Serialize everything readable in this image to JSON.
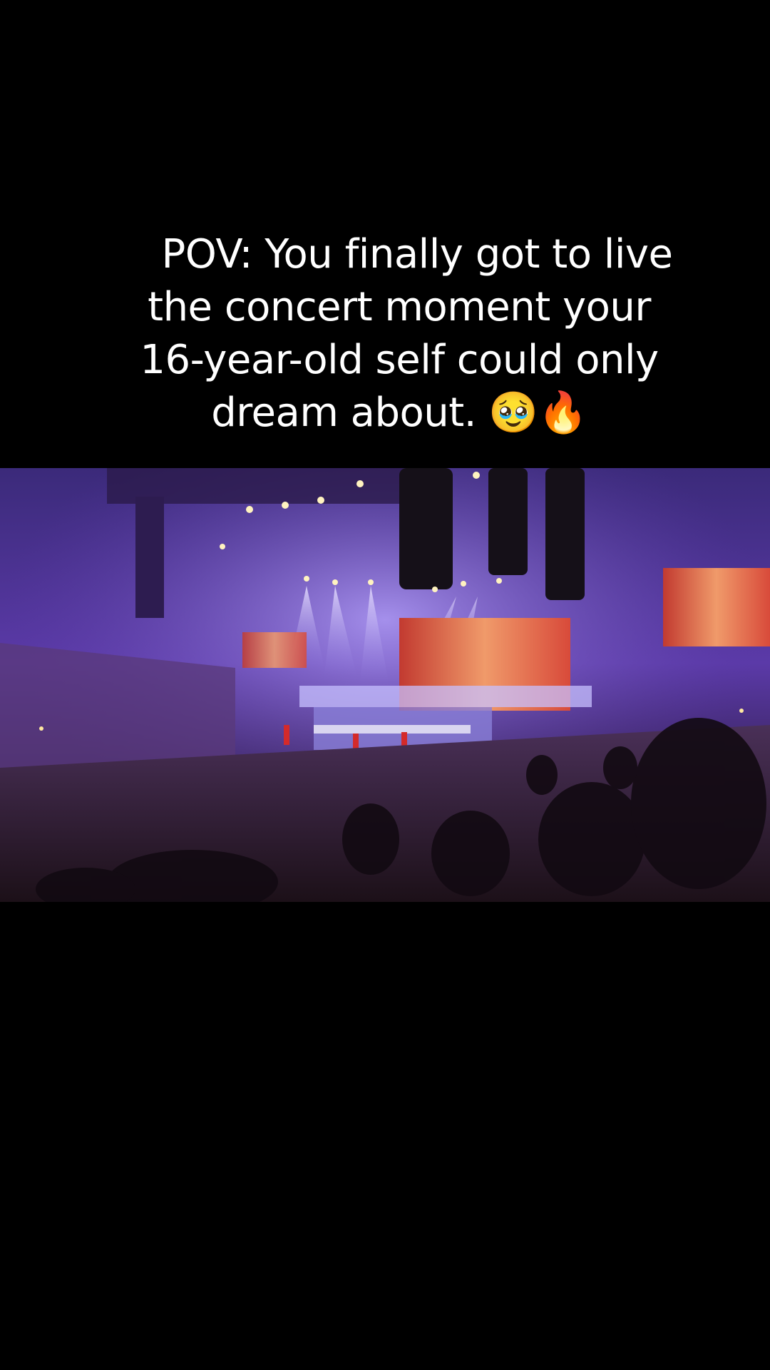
{
  "caption": {
    "line1": "POV: You finally got to live",
    "line2": "the concert moment your",
    "line3": "16-year-old self could only",
    "line4": "dream about. 🥹🔥"
  },
  "video": {
    "alt": "Concert arena with purple stage lighting, large screens and a crowd"
  },
  "colors": {
    "background": "#000000",
    "caption_text": "#ffffff",
    "stage_purple": "#5b3aa8",
    "screen_red": "#e0452f"
  }
}
